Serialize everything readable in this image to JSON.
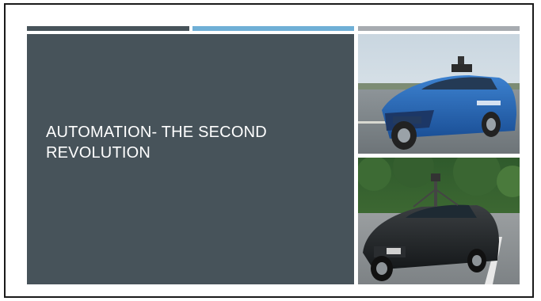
{
  "slide": {
    "title": "AUTOMATION- THE SECOND REVOLUTION"
  },
  "images": [
    {
      "name": "self-driving-ford-fusion-photo"
    },
    {
      "name": "self-driving-lexus-suv-photo"
    }
  ],
  "colors": {
    "panel": "#47535a",
    "accent_dark": "#47535a",
    "accent_blue": "#6fafd6",
    "accent_gray": "#a7abb0"
  }
}
